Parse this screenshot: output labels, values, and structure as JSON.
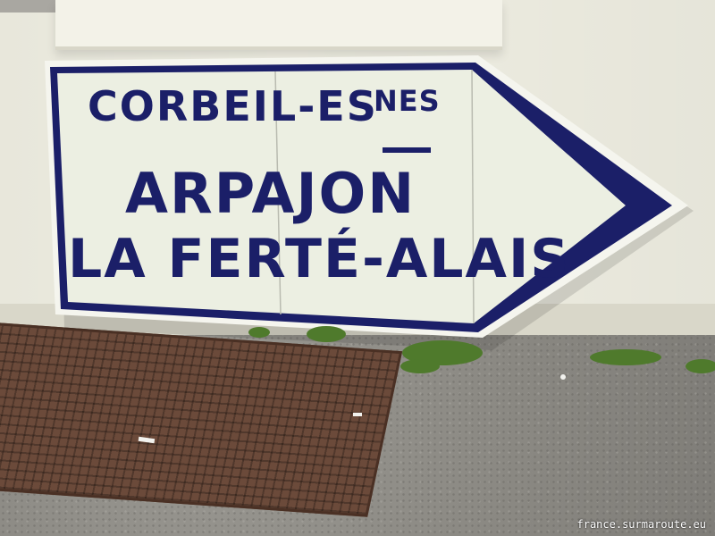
{
  "sign": {
    "line1": "CORBEIL-ES",
    "line1_superscript": "NES",
    "line2": "ARPAJON",
    "line3": "LA FERTÉ-ALAIS"
  },
  "watermark": "france.surmaroute.eu",
  "colors": {
    "sign_blue": "#1b1f68",
    "sign_face": "#ecefe2",
    "wall": "#efeee2",
    "grate_rust": "#6b4a3a"
  }
}
